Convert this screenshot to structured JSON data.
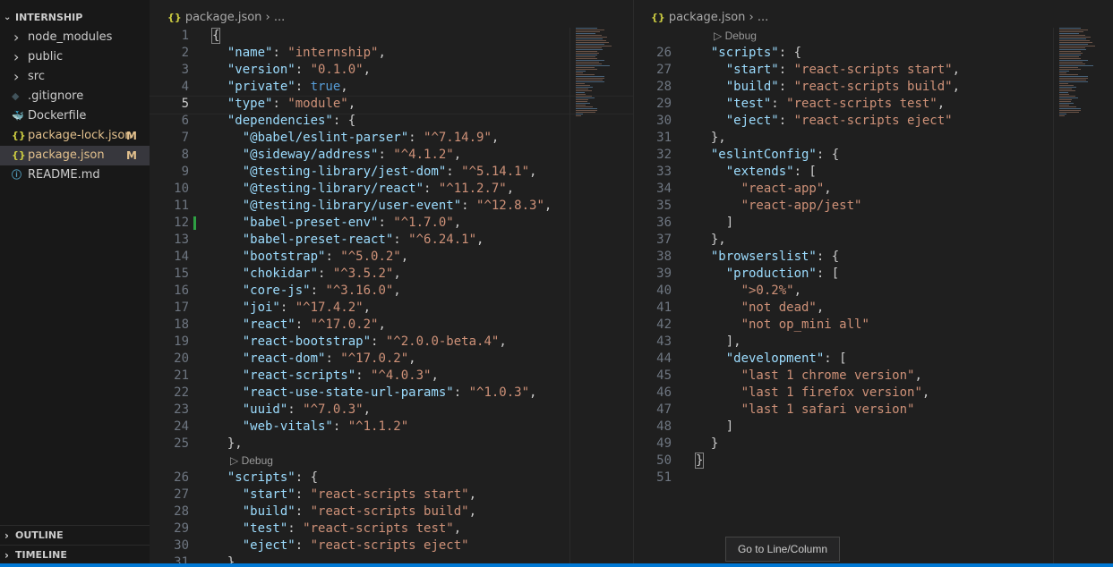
{
  "explorer": {
    "title": "INTERNSHIP",
    "items": [
      {
        "label": "node_modules",
        "type": "folder",
        "icon": "chevron-right-icon"
      },
      {
        "label": "public",
        "type": "folder",
        "icon": "chevron-right-icon"
      },
      {
        "label": "src",
        "type": "folder",
        "icon": "chevron-right-icon"
      },
      {
        "label": ".gitignore",
        "type": "file",
        "icon": "git-icon",
        "icon_glyph": "◆",
        "icon_color": "#41535b"
      },
      {
        "label": "Dockerfile",
        "type": "file",
        "icon": "docker-icon",
        "icon_glyph": "🐳",
        "icon_color": "#2496ed"
      },
      {
        "label": "package-lock.json",
        "type": "file",
        "icon": "json-icon",
        "icon_glyph": "{}",
        "icon_color": "#cbcb41",
        "badge": "M"
      },
      {
        "label": "package.json",
        "type": "file",
        "icon": "json-icon",
        "icon_glyph": "{}",
        "icon_color": "#cbcb41",
        "badge": "M",
        "active": true
      },
      {
        "label": "README.md",
        "type": "file",
        "icon": "info-icon",
        "icon_glyph": "ⓘ",
        "icon_color": "#519aba"
      }
    ],
    "outline_label": "OUTLINE",
    "timeline_label": "TIMELINE"
  },
  "editor_left": {
    "breadcrumb_file": "package.json",
    "breadcrumb_sep": "›",
    "breadcrumb_more": "...",
    "json_icon": "{}",
    "codelens": "Debug",
    "current_line": 5,
    "modified_line": 12,
    "lines": [
      {
        "n": 1,
        "html": "<span class=\"p bracket-hl\">{</span>"
      },
      {
        "n": 2,
        "html": "  <span class=\"k\">\"name\"</span><span class=\"p\">: </span><span class=\"s\">\"internship\"</span><span class=\"p\">,</span>"
      },
      {
        "n": 3,
        "html": "  <span class=\"k\">\"version\"</span><span class=\"p\">: </span><span class=\"s\">\"0.1.0\"</span><span class=\"p\">,</span>"
      },
      {
        "n": 4,
        "html": "  <span class=\"k\">\"private\"</span><span class=\"p\">: </span><span class=\"b\">true</span><span class=\"p\">,</span>"
      },
      {
        "n": 5,
        "html": "  <span class=\"k\">\"type\"</span><span class=\"p\">: </span><span class=\"s\">\"module\"</span><span class=\"p\">,</span>"
      },
      {
        "n": 6,
        "html": "  <span class=\"k\">\"dependencies\"</span><span class=\"p\">: {</span>"
      },
      {
        "n": 7,
        "html": "    <span class=\"k\">\"@babel/eslint-parser\"</span><span class=\"p\">: </span><span class=\"s\">\"^7.14.9\"</span><span class=\"p\">,</span>"
      },
      {
        "n": 8,
        "html": "    <span class=\"k\">\"@sideway/address\"</span><span class=\"p\">: </span><span class=\"s\">\"^4.1.2\"</span><span class=\"p\">,</span>"
      },
      {
        "n": 9,
        "html": "    <span class=\"k\">\"@testing-library/jest-dom\"</span><span class=\"p\">: </span><span class=\"s\">\"^5.14.1\"</span><span class=\"p\">,</span>"
      },
      {
        "n": 10,
        "html": "    <span class=\"k\">\"@testing-library/react\"</span><span class=\"p\">: </span><span class=\"s\">\"^11.2.7\"</span><span class=\"p\">,</span>"
      },
      {
        "n": 11,
        "html": "    <span class=\"k\">\"@testing-library/user-event\"</span><span class=\"p\">: </span><span class=\"s\">\"^12.8.3\"</span><span class=\"p\">,</span>"
      },
      {
        "n": 12,
        "html": "    <span class=\"k\">\"babel-preset-env\"</span><span class=\"p\">: </span><span class=\"s\">\"^1.7.0\"</span><span class=\"p\">,</span>"
      },
      {
        "n": 13,
        "html": "    <span class=\"k\">\"babel-preset-react\"</span><span class=\"p\">: </span><span class=\"s\">\"^6.24.1\"</span><span class=\"p\">,</span>"
      },
      {
        "n": 14,
        "html": "    <span class=\"k\">\"bootstrap\"</span><span class=\"p\">: </span><span class=\"s\">\"^5.0.2\"</span><span class=\"p\">,</span>"
      },
      {
        "n": 15,
        "html": "    <span class=\"k\">\"chokidar\"</span><span class=\"p\">: </span><span class=\"s\">\"^3.5.2\"</span><span class=\"p\">,</span>"
      },
      {
        "n": 16,
        "html": "    <span class=\"k\">\"core-js\"</span><span class=\"p\">: </span><span class=\"s\">\"^3.16.0\"</span><span class=\"p\">,</span>"
      },
      {
        "n": 17,
        "html": "    <span class=\"k\">\"joi\"</span><span class=\"p\">: </span><span class=\"s\">\"^17.4.2\"</span><span class=\"p\">,</span>"
      },
      {
        "n": 18,
        "html": "    <span class=\"k\">\"react\"</span><span class=\"p\">: </span><span class=\"s\">\"^17.0.2\"</span><span class=\"p\">,</span>"
      },
      {
        "n": 19,
        "html": "    <span class=\"k\">\"react-bootstrap\"</span><span class=\"p\">: </span><span class=\"s\">\"^2.0.0-beta.4\"</span><span class=\"p\">,</span>"
      },
      {
        "n": 20,
        "html": "    <span class=\"k\">\"react-dom\"</span><span class=\"p\">: </span><span class=\"s\">\"^17.0.2\"</span><span class=\"p\">,</span>"
      },
      {
        "n": 21,
        "html": "    <span class=\"k\">\"react-scripts\"</span><span class=\"p\">: </span><span class=\"s\">\"^4.0.3\"</span><span class=\"p\">,</span>"
      },
      {
        "n": 22,
        "html": "    <span class=\"k\">\"react-use-state-url-params\"</span><span class=\"p\">: </span><span class=\"s\">\"^1.0.3\"</span><span class=\"p\">,</span>"
      },
      {
        "n": 23,
        "html": "    <span class=\"k\">\"uuid\"</span><span class=\"p\">: </span><span class=\"s\">\"^7.0.3\"</span><span class=\"p\">,</span>"
      },
      {
        "n": 24,
        "html": "    <span class=\"k\">\"web-vitals\"</span><span class=\"p\">: </span><span class=\"s\">\"^1.1.2\"</span>"
      },
      {
        "n": 25,
        "html": "  <span class=\"p\">},</span>"
      },
      {
        "lens": true
      },
      {
        "n": 26,
        "html": "  <span class=\"k\">\"scripts\"</span><span class=\"p\">: {</span>"
      },
      {
        "n": 27,
        "html": "    <span class=\"k\">\"start\"</span><span class=\"p\">: </span><span class=\"s\">\"react-scripts start\"</span><span class=\"p\">,</span>"
      },
      {
        "n": 28,
        "html": "    <span class=\"k\">\"build\"</span><span class=\"p\">: </span><span class=\"s\">\"react-scripts build\"</span><span class=\"p\">,</span>"
      },
      {
        "n": 29,
        "html": "    <span class=\"k\">\"test\"</span><span class=\"p\">: </span><span class=\"s\">\"react-scripts test\"</span><span class=\"p\">,</span>"
      },
      {
        "n": 30,
        "html": "    <span class=\"k\">\"eject\"</span><span class=\"p\">: </span><span class=\"s\">\"react-scripts eject\"</span>"
      },
      {
        "n": 31,
        "html": "  <span class=\"p\">},</span>"
      }
    ]
  },
  "editor_right": {
    "breadcrumb_file": "package.json",
    "breadcrumb_sep": "›",
    "breadcrumb_more": "...",
    "json_icon": "{}",
    "codelens": "Debug",
    "lines": [
      {
        "lens": true
      },
      {
        "n": 26,
        "html": "  <span class=\"k\">\"scripts\"</span><span class=\"p\">: {</span>"
      },
      {
        "n": 27,
        "html": "    <span class=\"k\">\"start\"</span><span class=\"p\">: </span><span class=\"s\">\"react-scripts start\"</span><span class=\"p\">,</span>"
      },
      {
        "n": 28,
        "html": "    <span class=\"k\">\"build\"</span><span class=\"p\">: </span><span class=\"s\">\"react-scripts build\"</span><span class=\"p\">,</span>"
      },
      {
        "n": 29,
        "html": "    <span class=\"k\">\"test\"</span><span class=\"p\">: </span><span class=\"s\">\"react-scripts test\"</span><span class=\"p\">,</span>"
      },
      {
        "n": 30,
        "html": "    <span class=\"k\">\"eject\"</span><span class=\"p\">: </span><span class=\"s\">\"react-scripts eject\"</span>"
      },
      {
        "n": 31,
        "html": "  <span class=\"p\">},</span>"
      },
      {
        "n": 32,
        "html": "  <span class=\"k\">\"eslintConfig\"</span><span class=\"p\">: {</span>"
      },
      {
        "n": 33,
        "html": "    <span class=\"k\">\"extends\"</span><span class=\"p\">: [</span>"
      },
      {
        "n": 34,
        "html": "      <span class=\"s\">\"react-app\"</span><span class=\"p\">,</span>"
      },
      {
        "n": 35,
        "html": "      <span class=\"s\">\"react-app/jest\"</span>"
      },
      {
        "n": 36,
        "html": "    <span class=\"p\">]</span>"
      },
      {
        "n": 37,
        "html": "  <span class=\"p\">},</span>"
      },
      {
        "n": 38,
        "html": "  <span class=\"k\">\"browserslist\"</span><span class=\"p\">: {</span>"
      },
      {
        "n": 39,
        "html": "    <span class=\"k\">\"production\"</span><span class=\"p\">: [</span>"
      },
      {
        "n": 40,
        "html": "      <span class=\"s\">\">0.2%\"</span><span class=\"p\">,</span>"
      },
      {
        "n": 41,
        "html": "      <span class=\"s\">\"not dead\"</span><span class=\"p\">,</span>"
      },
      {
        "n": 42,
        "html": "      <span class=\"s\">\"not op_mini all\"</span>"
      },
      {
        "n": 43,
        "html": "    <span class=\"p\">],</span>"
      },
      {
        "n": 44,
        "html": "    <span class=\"k\">\"development\"</span><span class=\"p\">: [</span>"
      },
      {
        "n": 45,
        "html": "      <span class=\"s\">\"last 1 chrome version\"</span><span class=\"p\">,</span>"
      },
      {
        "n": 46,
        "html": "      <span class=\"s\">\"last 1 firefox version\"</span><span class=\"p\">,</span>"
      },
      {
        "n": 47,
        "html": "      <span class=\"s\">\"last 1 safari version\"</span>"
      },
      {
        "n": 48,
        "html": "    <span class=\"p\">]</span>"
      },
      {
        "n": 49,
        "html": "  <span class=\"p\">}</span>"
      },
      {
        "n": 50,
        "html": "<span class=\"p bracket-hl\">}</span>"
      },
      {
        "n": 51,
        "html": ""
      }
    ]
  },
  "tooltip": "Go to Line/Column",
  "colors": {
    "accent": "#0078d4",
    "key": "#9cdcfe",
    "string": "#ce9178",
    "keyword": "#569cd6",
    "modified": "#e2c08d",
    "added": "#2ea043"
  }
}
